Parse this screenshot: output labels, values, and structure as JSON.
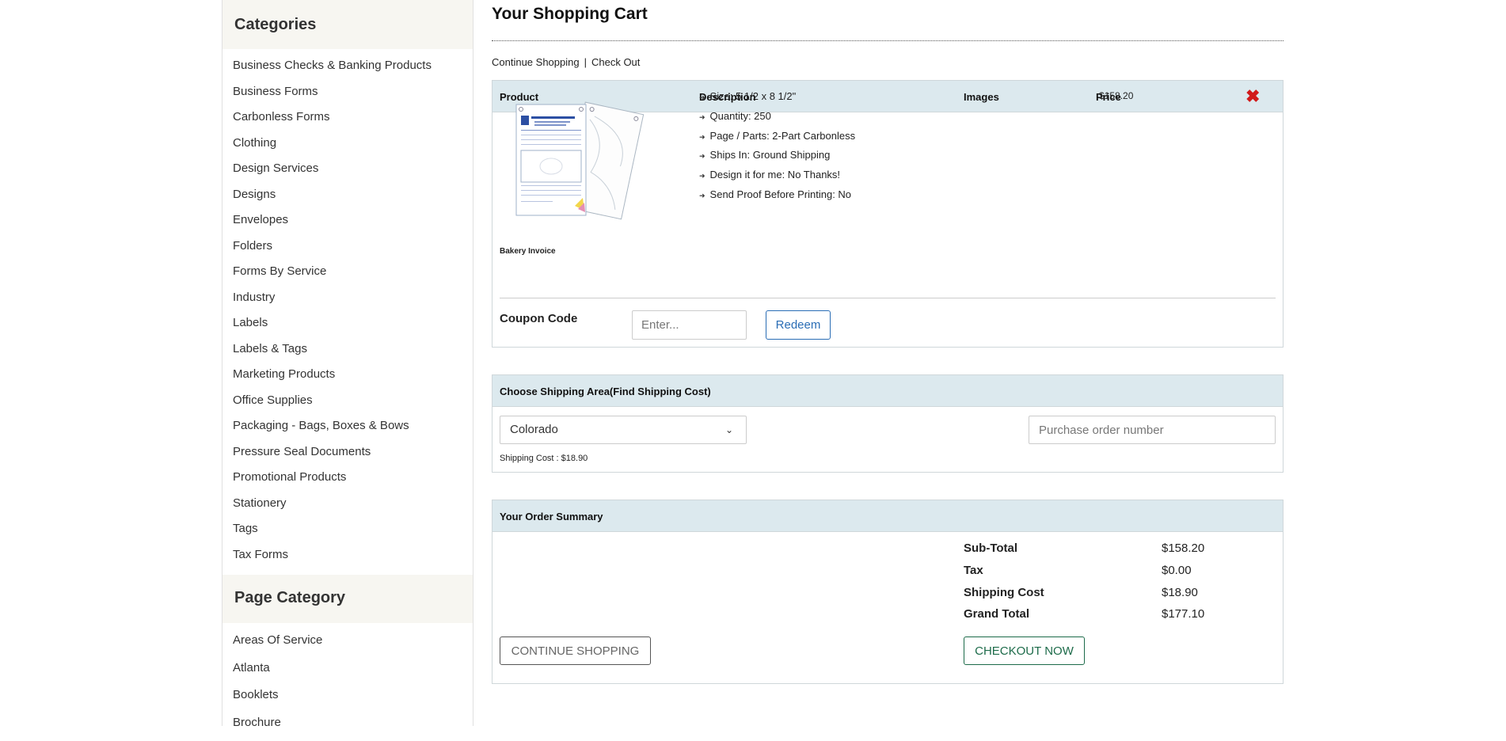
{
  "sidebar": {
    "categories_title": "Categories",
    "categories": [
      "Business Checks & Banking Products",
      "Business Forms",
      "Carbonless Forms",
      "Clothing",
      "Design Services",
      "Designs",
      "Envelopes",
      "Folders",
      "Forms By Service",
      "Industry",
      "Labels",
      "Labels & Tags",
      "Marketing Products",
      "Office Supplies",
      "Packaging - Bags, Boxes & Bows",
      "Pressure Seal Documents",
      "Promotional Products",
      "Stationery",
      "Tags",
      "Tax Forms"
    ],
    "page_category_title": "Page Category",
    "page_categories": [
      "Areas Of Service",
      "Atlanta",
      "Booklets",
      "Brochure"
    ]
  },
  "main": {
    "title": "Your Shopping Cart",
    "links": {
      "continue": "Continue Shopping",
      "separator": "|",
      "checkout": "Check Out"
    },
    "cart_headers": {
      "product": "Product",
      "description": "Description",
      "images": "Images",
      "price": "Price"
    },
    "item": {
      "name": "Bakery Invoice",
      "details": [
        "Size: 5 1/2 x 8 1/2\"",
        "Quantity: 250",
        "Page / Parts: 2-Part Carbonless",
        "Ships In: Ground Shipping",
        "Design it for me: No Thanks!",
        "Send Proof Before Printing: No"
      ],
      "price": "$158.20",
      "remove_icon": "close-x-icon"
    },
    "coupon": {
      "label": "Coupon Code",
      "placeholder": "Enter...",
      "button": "Redeem"
    },
    "shipping": {
      "header": "Choose Shipping Area(Find Shipping Cost)",
      "selected_state": "Colorado",
      "cost_text": "Shipping Cost : $18.90",
      "po_placeholder": "Purchase order number"
    },
    "summary": {
      "header": "Your Order Summary",
      "rows": [
        {
          "label": "Sub-Total",
          "value": "$158.20"
        },
        {
          "label": "Tax",
          "value": "$0.00"
        },
        {
          "label": "Shipping Cost",
          "value": "$18.90"
        },
        {
          "label": "Grand Total",
          "value": "$177.10"
        }
      ],
      "continue_button": "CONTINUE SHOPPING",
      "checkout_button": "CHECKOUT NOW"
    }
  },
  "colors": {
    "header_bg": "#dce9ee",
    "sidebar_header_bg": "#f7f6f1",
    "remove_red": "#d11a1a",
    "redeem_blue": "#2a6db5",
    "checkout_green": "#1d6b4a"
  }
}
